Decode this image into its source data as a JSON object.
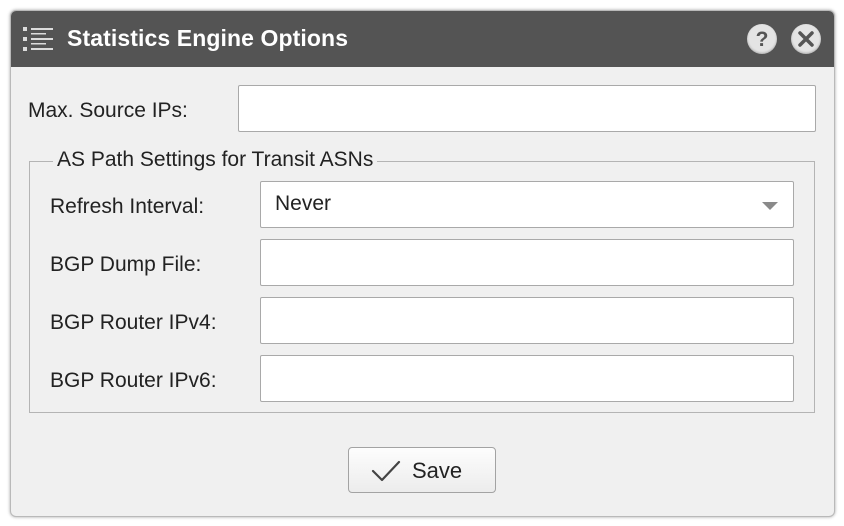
{
  "dialog": {
    "title": "Statistics Engine Options",
    "icons": {
      "menu": "list-icon",
      "help": "help-icon",
      "close": "close-icon"
    }
  },
  "form": {
    "max_source_ips": {
      "label": "Max. Source IPs:",
      "value": ""
    },
    "as_path_group": {
      "legend": "AS Path Settings for Transit ASNs",
      "refresh_interval": {
        "label": "Refresh Interval:",
        "value": "Never"
      },
      "bgp_dump_file": {
        "label": "BGP Dump File:",
        "value": ""
      },
      "bgp_router_ipv4": {
        "label": "BGP Router IPv4:",
        "value": ""
      },
      "bgp_router_ipv6": {
        "label": "BGP Router IPv6:",
        "value": ""
      }
    }
  },
  "actions": {
    "save_label": "Save",
    "save_icon": "checkmark-icon"
  },
  "colors": {
    "titlebar": "#545454",
    "body": "#f0f0f0"
  }
}
